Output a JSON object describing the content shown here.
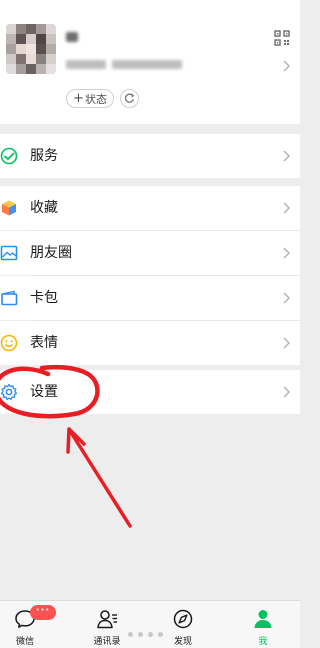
{
  "profile": {
    "status_plus": "+",
    "status_label": "状态"
  },
  "menu": {
    "items": [
      {
        "label": "服务",
        "icon": "service-icon"
      },
      {
        "label": "收藏",
        "icon": "favorites-cube-icon"
      },
      {
        "label": "朋友圈",
        "icon": "moments-photo-icon"
      },
      {
        "label": "卡包",
        "icon": "card-wallet-icon"
      },
      {
        "label": "表情",
        "icon": "sticker-face-icon"
      },
      {
        "label": "设置",
        "icon": "settings-gear-icon"
      }
    ]
  },
  "tabbar": {
    "tabs": [
      {
        "label": "微信",
        "icon": "chat-bubble-icon"
      },
      {
        "label": "通讯录",
        "icon": "contacts-icon"
      },
      {
        "label": "发现",
        "icon": "compass-icon"
      },
      {
        "label": "我",
        "icon": "me-person-icon"
      }
    ],
    "badge": "···",
    "active_tab": "我"
  },
  "colors": {
    "accent_green": "#07c160",
    "annotation_red": "#e81e25",
    "badge_red": "#fa5151"
  }
}
